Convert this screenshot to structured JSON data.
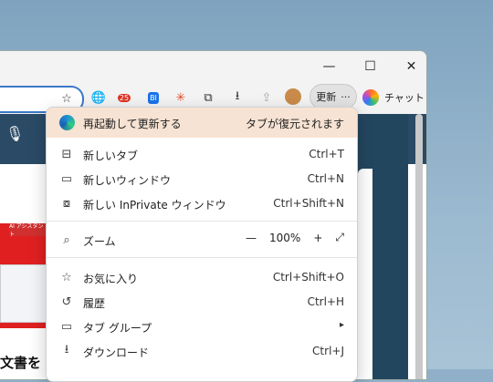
{
  "window_controls": {
    "minimize": "—",
    "maximize": "☐",
    "close": "✕"
  },
  "toolbar": {
    "badge_count": "25",
    "bi_label": "BI",
    "update_label": "更新",
    "more_label": "···",
    "chat_label": "チャット"
  },
  "page": {
    "ai_badge": "AI アシスタント",
    "bottom_text": "文書を"
  },
  "menu": {
    "banner": {
      "label": "再起動して更新する",
      "right": "タブが復元されます"
    },
    "items": [
      {
        "label": "新しいタブ",
        "shortcut": "Ctrl+T"
      },
      {
        "label": "新しいウィンドウ",
        "shortcut": "Ctrl+N"
      },
      {
        "label": "新しい InPrivate ウィンドウ",
        "shortcut": "Ctrl+Shift+N"
      },
      {
        "label": "ズーム",
        "zoom_value": "100%",
        "minus": "—",
        "plus": "+",
        "expand": "⤢"
      },
      {
        "label": "お気に入り",
        "shortcut": "Ctrl+Shift+O"
      },
      {
        "label": "履歴",
        "shortcut": "Ctrl+H"
      },
      {
        "label": "タブ グループ",
        "submenu": "▸"
      },
      {
        "label": "ダウンロード",
        "shortcut": "Ctrl+J"
      }
    ]
  }
}
